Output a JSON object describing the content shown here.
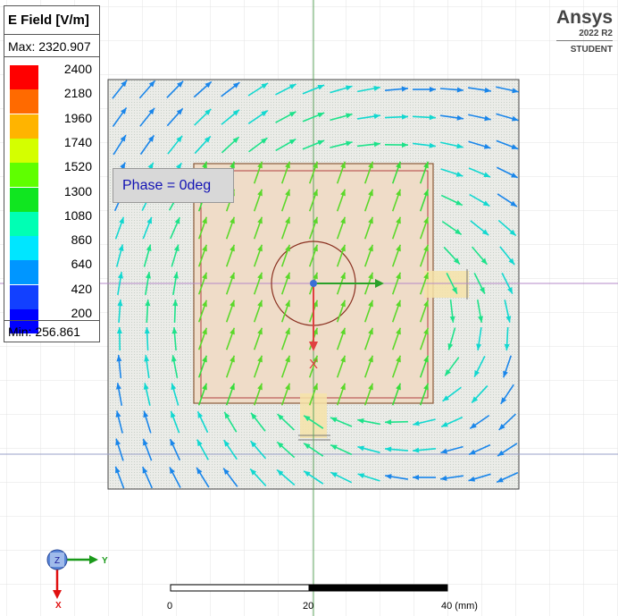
{
  "legend": {
    "title": "E Field [V/m]",
    "max": "Max: 2320.907",
    "min": "Min:  256.861",
    "ticks": [
      "2400",
      "2180",
      "1960",
      "1740",
      "1520",
      "1300",
      "1080",
      "860",
      "640",
      "420",
      "200"
    ],
    "colors": [
      "#ff0000",
      "#ff6a00",
      "#ffb400",
      "#d4ff00",
      "#5fff00",
      "#10e620",
      "#00ffb4",
      "#00e6ff",
      "#0096ff",
      "#1240ff",
      "#0000ff"
    ]
  },
  "annotation": {
    "phase": "Phase = 0deg"
  },
  "brand": {
    "name": "Ansys",
    "version": "2022 R2",
    "edition": "STUDENT"
  },
  "triad": {
    "z": "Z",
    "y": "Y",
    "x": "X"
  },
  "port_label": "X",
  "scale": {
    "labels": [
      "0",
      "20",
      "40 (mm)"
    ]
  }
}
